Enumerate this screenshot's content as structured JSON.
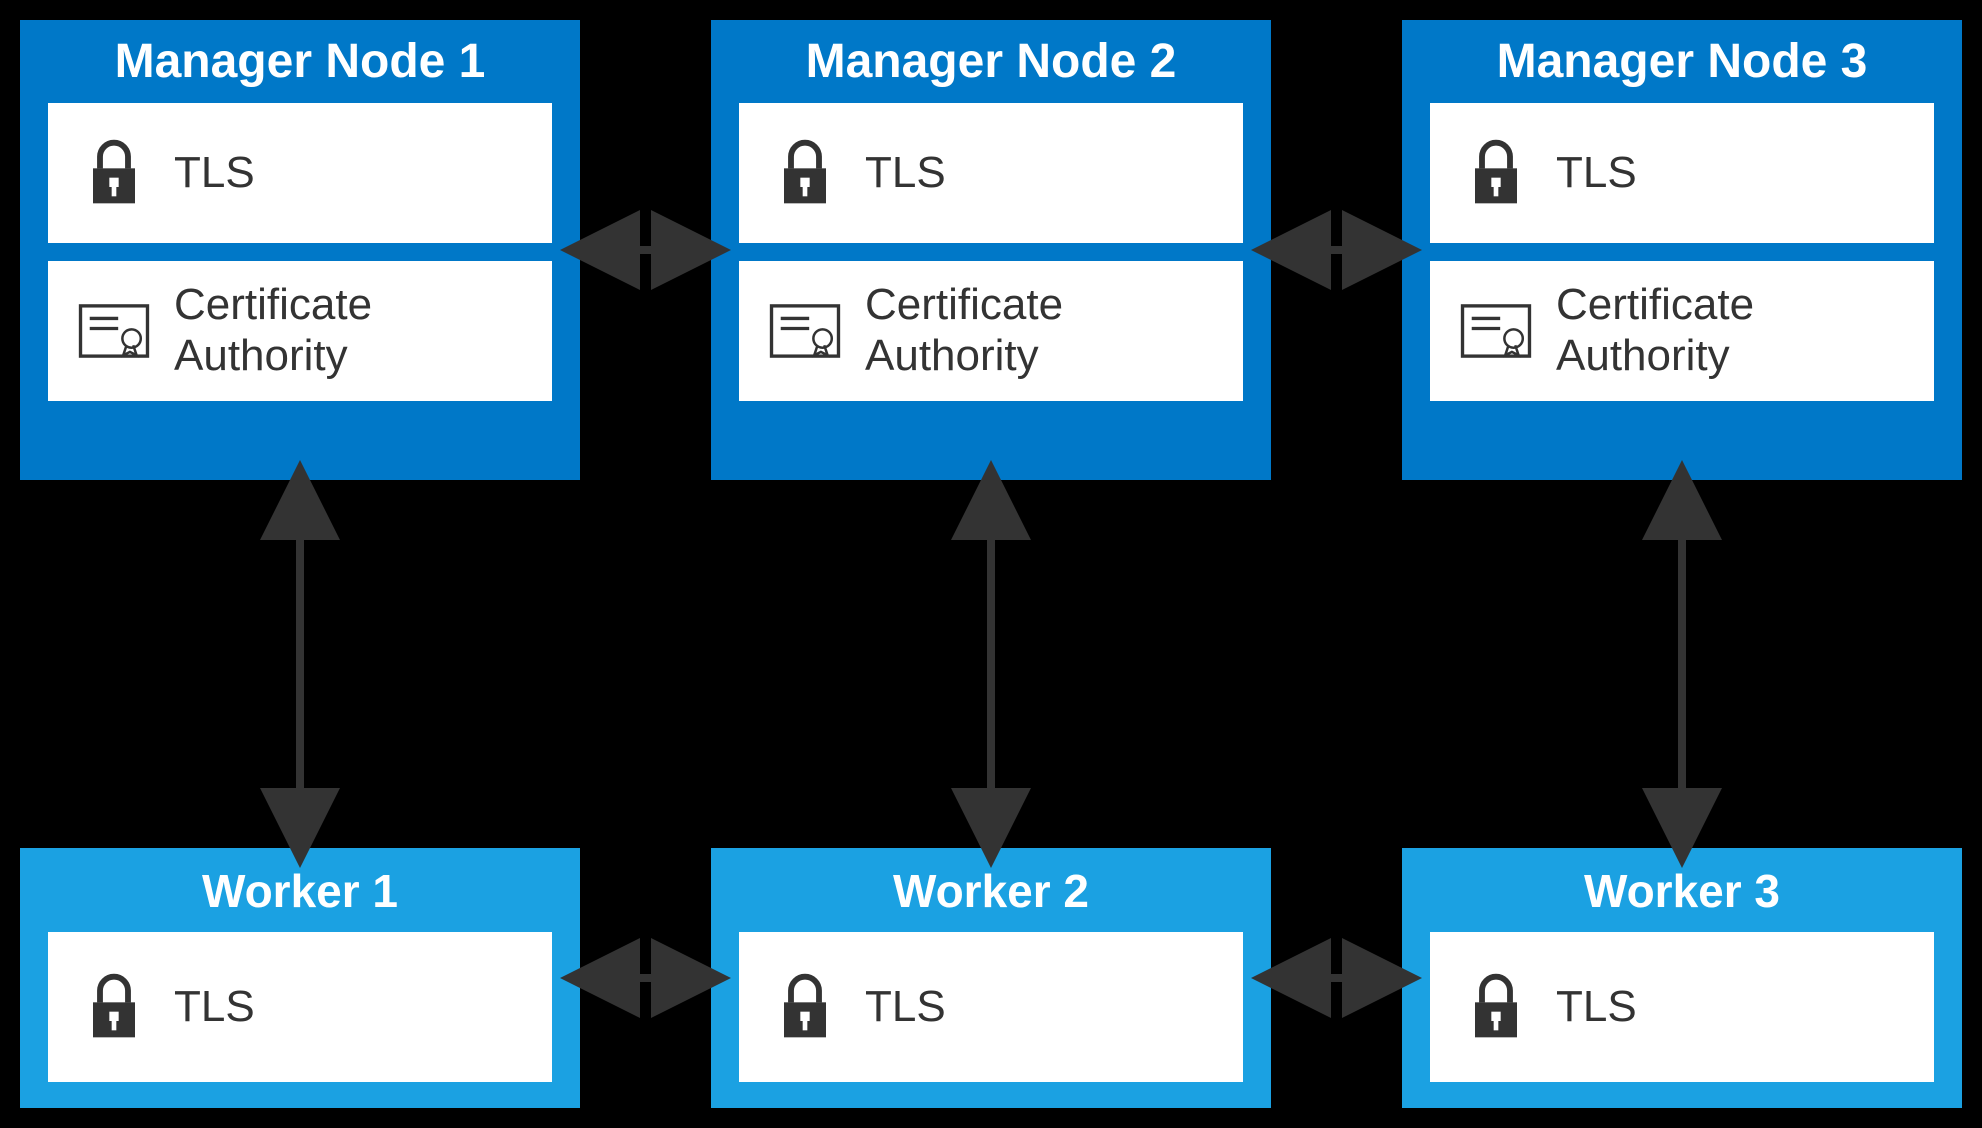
{
  "managers": [
    {
      "title": "Manager Node 1",
      "tls": "TLS",
      "ca": "Certificate Authority"
    },
    {
      "title": "Manager Node 2",
      "tls": "TLS",
      "ca": "Certificate Authority"
    },
    {
      "title": "Manager Node 3",
      "tls": "TLS",
      "ca": "Certificate Authority"
    }
  ],
  "workers": [
    {
      "title": "Worker 1",
      "tls": "TLS"
    },
    {
      "title": "Worker 2",
      "tls": "TLS"
    },
    {
      "title": "Worker 3",
      "tls": "TLS"
    }
  ],
  "colors": {
    "manager": "#0078c8",
    "worker": "#1ba1e2",
    "arrow": "#333333"
  }
}
